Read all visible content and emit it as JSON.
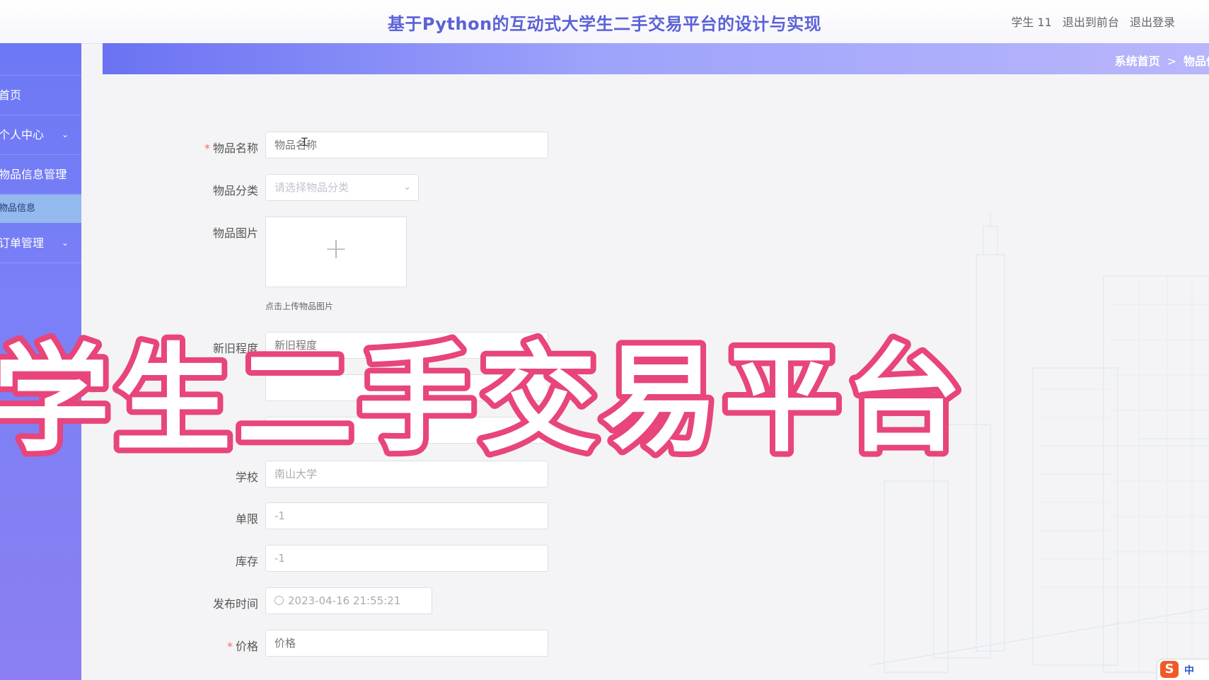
{
  "header": {
    "title": "基于Python的互动式大学生二手交易平台的设计与实现",
    "user": "学生 11",
    "front_link": "退出到前台",
    "logout_link": "退出登录"
  },
  "breadcrumb": {
    "home": "系统首页",
    "separator": ">",
    "current": "物品信息"
  },
  "sidebar": {
    "items": [
      {
        "label": "首页"
      },
      {
        "label": "个人中心",
        "chevron": "⌄"
      },
      {
        "label": "物品信息管理",
        "chevron": "⌃"
      },
      {
        "label": "物品信息"
      },
      {
        "label": "订单管理",
        "chevron": "⌄"
      }
    ]
  },
  "form": {
    "name": {
      "label": "物品名称",
      "placeholder": "物品名称"
    },
    "category": {
      "label": "物品分类",
      "placeholder": "请选择物品分类"
    },
    "image": {
      "label": "物品图片",
      "hint": "点击上传物品图片"
    },
    "condition": {
      "label": "新旧程度",
      "placeholder": "新旧程度"
    },
    "school": {
      "label": "学校",
      "value": "南山大学"
    },
    "limit": {
      "label": "单限",
      "value": "-1"
    },
    "stock": {
      "label": "库存",
      "value": "-1"
    },
    "publish_time": {
      "label": "发布时间",
      "value": "2023-04-16 21:55:21"
    },
    "price": {
      "label": "价格",
      "placeholder": "价格"
    },
    "required_mark": "*"
  },
  "overlay": {
    "text": "学生二手交易平台",
    "fill": "#ffffff",
    "stroke": "#e8457a"
  },
  "ime": {
    "icon": "S",
    "mode": "中"
  },
  "colors": {
    "accent": "#5b62d6",
    "sidebar": "#7078f4",
    "required": "#f56c6c"
  }
}
